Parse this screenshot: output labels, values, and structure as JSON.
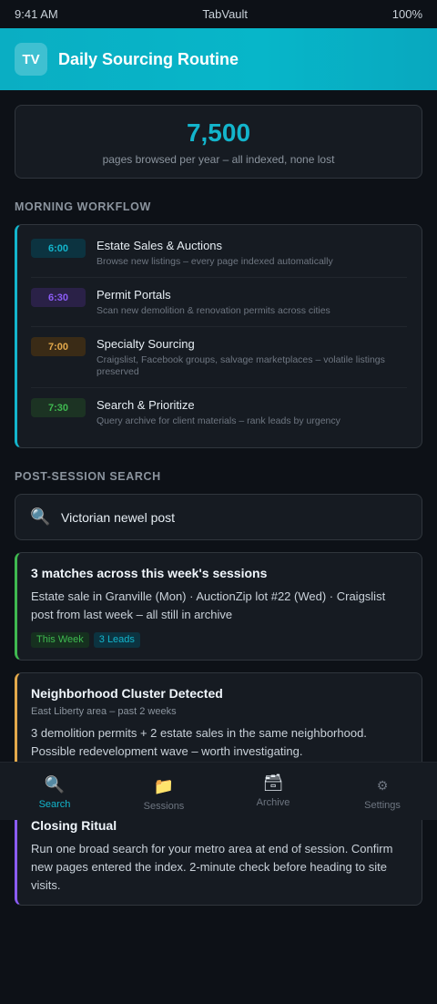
{
  "status_bar": {
    "time": "9:41 AM",
    "app": "TabVault",
    "battery": "100%"
  },
  "header": {
    "logo": "TV",
    "title": "Daily Sourcing Routine"
  },
  "stat": {
    "value": "7,500",
    "label": "pages browsed per year – all indexed, none lost"
  },
  "workflow": {
    "heading": "MORNING WORKFLOW",
    "accent": "#13b5cc",
    "items": [
      {
        "time": "6:00",
        "title": "Estate Sales & Auctions",
        "desc": "Browse new listings – every page indexed automatically",
        "badge_bg": "#0c3340",
        "badge_fg": "#13b5cc"
      },
      {
        "time": "6:30",
        "title": "Permit Portals",
        "desc": "Scan new demolition & renovation permits across cities",
        "badge_bg": "#2a2147",
        "badge_fg": "#8b5cf6"
      },
      {
        "time": "7:00",
        "title": "Specialty Sourcing",
        "desc": "Craigslist, Facebook groups, salvage marketplaces – volatile listings preserved",
        "badge_bg": "#3a2b16",
        "badge_fg": "#e3a94b"
      },
      {
        "time": "7:30",
        "title": "Search & Prioritize",
        "desc": "Query archive for client materials – rank leads by urgency",
        "badge_bg": "#1c3323",
        "badge_fg": "#3fb950"
      }
    ]
  },
  "post_search": {
    "heading": "POST-SESSION SEARCH",
    "query": "Victorian newel post"
  },
  "result": {
    "title": "3 matches across this week's sessions",
    "desc": "Estate sale in Granville (Mon) · AuctionZip lot #22 (Wed) · Craigslist post from last week – all still in archive",
    "tags": [
      {
        "label": "This Week",
        "bg": "#16301f",
        "fg": "#3fb950"
      },
      {
        "label": "3 Leads",
        "bg": "#0c3340",
        "fg": "#13b5cc"
      }
    ]
  },
  "cluster": {
    "title": "Neighborhood Cluster Detected",
    "sub": "East Liberty area – past 2 weeks",
    "desc": "3 demolition permits + 2 estate sales in the same neighborhood. Possible redevelopment wave – worth investigating."
  },
  "closing": {
    "title": "Closing Ritual",
    "desc": "Run one broad search for your metro area at end of session. Confirm new pages entered the index. 2-minute check before heading to site visits."
  },
  "nav": [
    {
      "label": "Search",
      "icon": "🔍",
      "icon_name": "search-icon",
      "active": true
    },
    {
      "label": "Sessions",
      "icon": "📁",
      "icon_name": "folder-icon",
      "active": false
    },
    {
      "label": "Archive",
      "icon": "🗃",
      "icon_name": "archive-box-icon",
      "active": false
    },
    {
      "label": "Settings",
      "icon": "⚙",
      "icon_name": "gear-icon",
      "active": false
    }
  ]
}
